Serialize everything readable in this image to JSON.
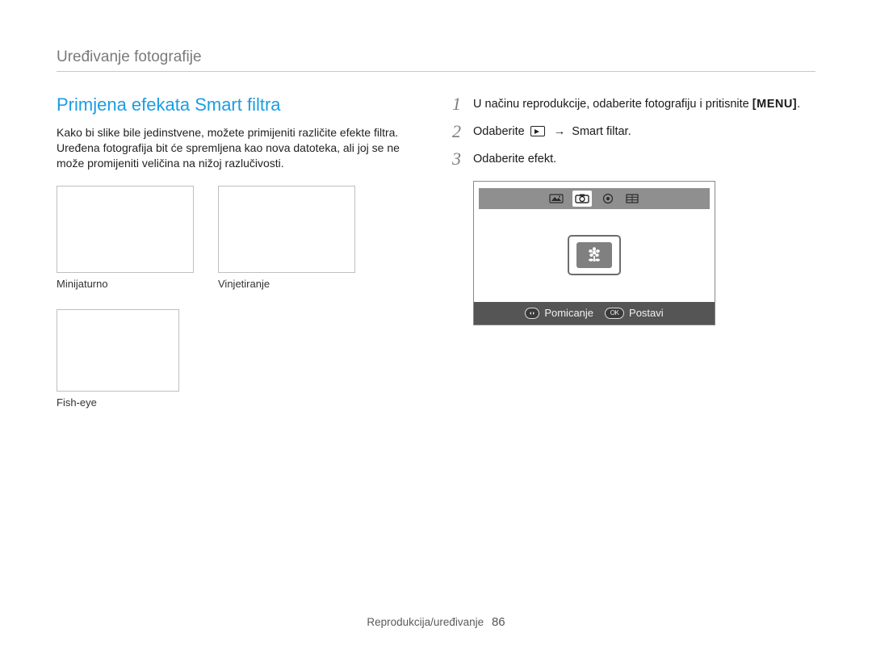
{
  "header": {
    "breadcrumb": "Uređivanje fotografije"
  },
  "left": {
    "heading": "Primjena efekata Smart filtra",
    "paragraph": "Kako bi slike bile jedinstvene, možete primijeniti različite efekte filtra. Uređena fotografija bit će spremljena kao nova datoteka, ali joj se ne može promijeniti veličina na nižoj razlučivosti.",
    "thumbs": [
      {
        "caption": "Minijaturno"
      },
      {
        "caption": "Vinjetiranje"
      },
      {
        "caption": "Fish-eye"
      }
    ]
  },
  "steps": {
    "s1_num": "1",
    "s1_text_a": "U načinu reprodukcije, odaberite fotografiju i pritisnite ",
    "s1_button": "[MENU]",
    "s1_text_b": ".",
    "s2_num": "2",
    "s2_pre": "Odaberite ",
    "s2_arrow": "→",
    "s2_post": " Smart filtar.",
    "s3_num": "3",
    "s3_text": "Odaberite efekt."
  },
  "screen": {
    "footer": {
      "left_label": "Pomicanje",
      "right_btn": "OK",
      "right_label": "Postavi"
    }
  },
  "footer": {
    "section": "Reprodukcija/uređivanje",
    "page": "86"
  }
}
